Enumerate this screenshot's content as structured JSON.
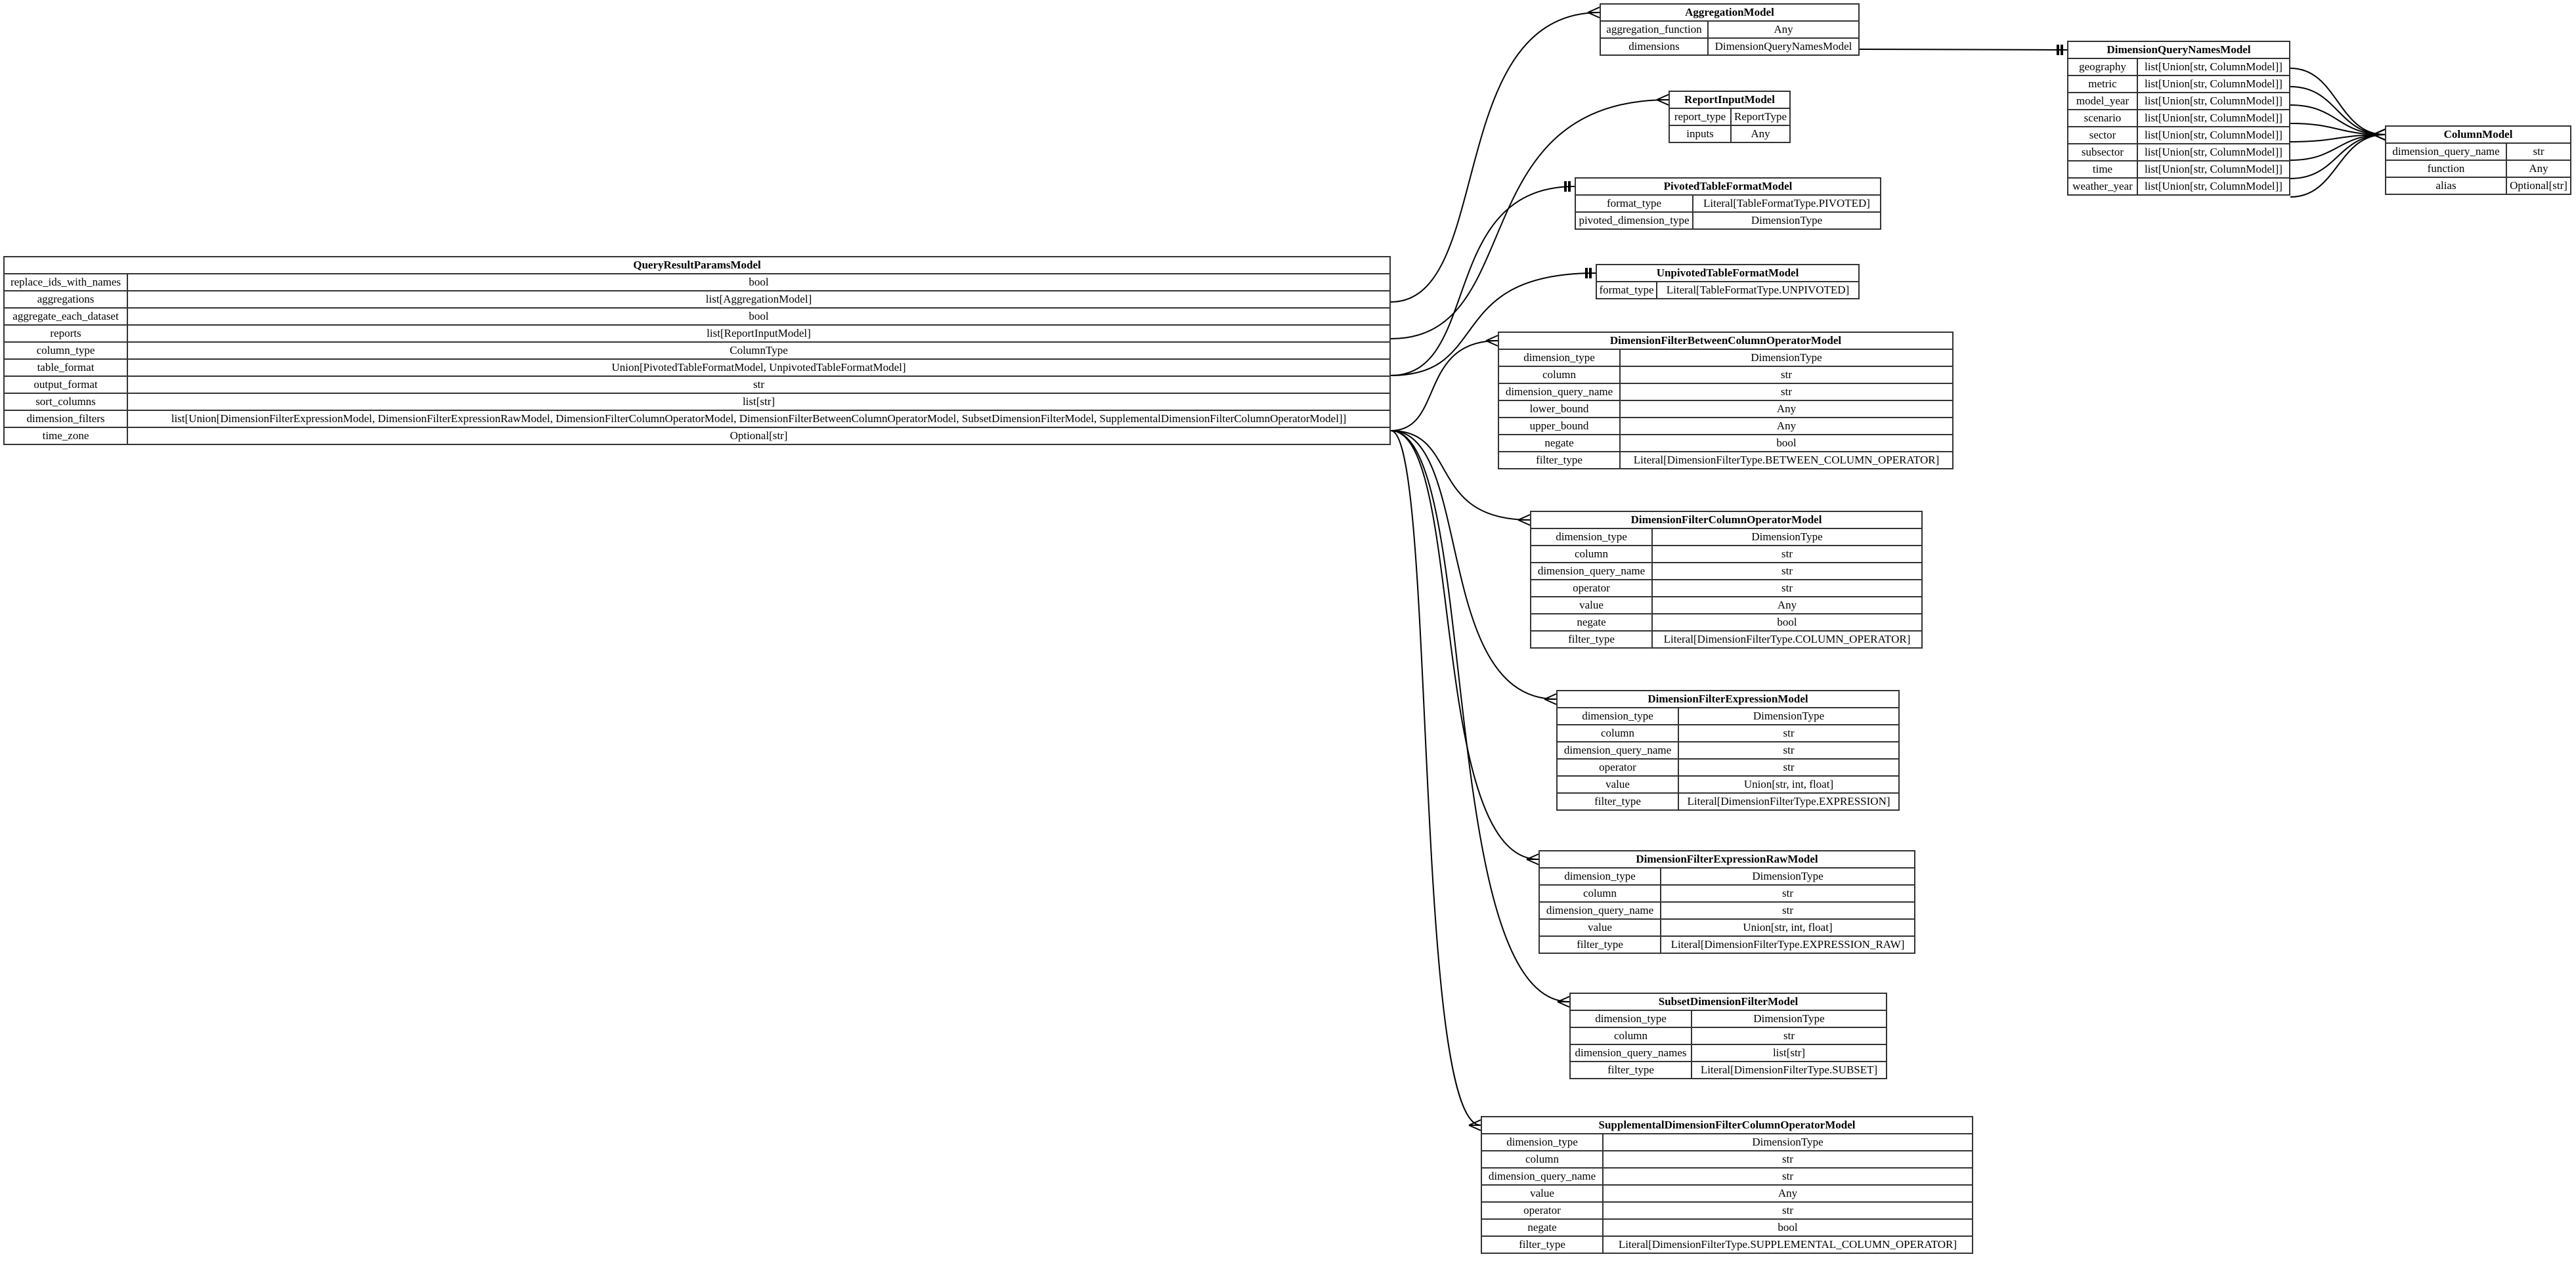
{
  "diagram": {
    "type": "entity-relationship",
    "entities": {
      "query_result_params": {
        "name": "QueryResultParamsModel",
        "fields": [
          {
            "name": "replace_ids_with_names",
            "type": "bool"
          },
          {
            "name": "aggregations",
            "type": "list[AggregationModel]"
          },
          {
            "name": "aggregate_each_dataset",
            "type": "bool"
          },
          {
            "name": "reports",
            "type": "list[ReportInputModel]"
          },
          {
            "name": "column_type",
            "type": "ColumnType"
          },
          {
            "name": "table_format",
            "type": "Union[PivotedTableFormatModel, UnpivotedTableFormatModel]"
          },
          {
            "name": "output_format",
            "type": "str"
          },
          {
            "name": "sort_columns",
            "type": "list[str]"
          },
          {
            "name": "dimension_filters",
            "type": "list[Union[DimensionFilterExpressionModel, DimensionFilterExpressionRawModel, DimensionFilterColumnOperatorModel, DimensionFilterBetweenColumnOperatorModel, SubsetDimensionFilterModel, SupplementalDimensionFilterColumnOperatorModel]]"
          },
          {
            "name": "time_zone",
            "type": "Optional[str]"
          }
        ]
      },
      "aggregation": {
        "name": "AggregationModel",
        "fields": [
          {
            "name": "aggregation_function",
            "type": "Any"
          },
          {
            "name": "dimensions",
            "type": "DimensionQueryNamesModel"
          }
        ]
      },
      "report_input": {
        "name": "ReportInputModel",
        "fields": [
          {
            "name": "report_type",
            "type": "ReportType"
          },
          {
            "name": "inputs",
            "type": "Any"
          }
        ]
      },
      "pivoted_table_format": {
        "name": "PivotedTableFormatModel",
        "fields": [
          {
            "name": "format_type",
            "type": "Literal[TableFormatType.PIVOTED]"
          },
          {
            "name": "pivoted_dimension_type",
            "type": "DimensionType"
          }
        ]
      },
      "unpivoted_table_format": {
        "name": "UnpivotedTableFormatModel",
        "fields": [
          {
            "name": "format_type",
            "type": "Literal[TableFormatType.UNPIVOTED]"
          }
        ]
      },
      "dimension_query_names": {
        "name": "DimensionQueryNamesModel",
        "fields": [
          {
            "name": "geography",
            "type": "list[Union[str, ColumnModel]]"
          },
          {
            "name": "metric",
            "type": "list[Union[str, ColumnModel]]"
          },
          {
            "name": "model_year",
            "type": "list[Union[str, ColumnModel]]"
          },
          {
            "name": "scenario",
            "type": "list[Union[str, ColumnModel]]"
          },
          {
            "name": "sector",
            "type": "list[Union[str, ColumnModel]]"
          },
          {
            "name": "subsector",
            "type": "list[Union[str, ColumnModel]]"
          },
          {
            "name": "time",
            "type": "list[Union[str, ColumnModel]]"
          },
          {
            "name": "weather_year",
            "type": "list[Union[str, ColumnModel]]"
          }
        ]
      },
      "column": {
        "name": "ColumnModel",
        "fields": [
          {
            "name": "dimension_query_name",
            "type": "str"
          },
          {
            "name": "function",
            "type": "Any"
          },
          {
            "name": "alias",
            "type": "Optional[str]"
          }
        ]
      },
      "df_between_column_operator": {
        "name": "DimensionFilterBetweenColumnOperatorModel",
        "fields": [
          {
            "name": "dimension_type",
            "type": "DimensionType"
          },
          {
            "name": "column",
            "type": "str"
          },
          {
            "name": "dimension_query_name",
            "type": "str"
          },
          {
            "name": "lower_bound",
            "type": "Any"
          },
          {
            "name": "upper_bound",
            "type": "Any"
          },
          {
            "name": "negate",
            "type": "bool"
          },
          {
            "name": "filter_type",
            "type": "Literal[DimensionFilterType.BETWEEN_COLUMN_OPERATOR]"
          }
        ]
      },
      "df_column_operator": {
        "name": "DimensionFilterColumnOperatorModel",
        "fields": [
          {
            "name": "dimension_type",
            "type": "DimensionType"
          },
          {
            "name": "column",
            "type": "str"
          },
          {
            "name": "dimension_query_name",
            "type": "str"
          },
          {
            "name": "operator",
            "type": "str"
          },
          {
            "name": "value",
            "type": "Any"
          },
          {
            "name": "negate",
            "type": "bool"
          },
          {
            "name": "filter_type",
            "type": "Literal[DimensionFilterType.COLUMN_OPERATOR]"
          }
        ]
      },
      "df_expression": {
        "name": "DimensionFilterExpressionModel",
        "fields": [
          {
            "name": "dimension_type",
            "type": "DimensionType"
          },
          {
            "name": "column",
            "type": "str"
          },
          {
            "name": "dimension_query_name",
            "type": "str"
          },
          {
            "name": "operator",
            "type": "str"
          },
          {
            "name": "value",
            "type": "Union[str, int, float]"
          },
          {
            "name": "filter_type",
            "type": "Literal[DimensionFilterType.EXPRESSION]"
          }
        ]
      },
      "df_expression_raw": {
        "name": "DimensionFilterExpressionRawModel",
        "fields": [
          {
            "name": "dimension_type",
            "type": "DimensionType"
          },
          {
            "name": "column",
            "type": "str"
          },
          {
            "name": "dimension_query_name",
            "type": "str"
          },
          {
            "name": "value",
            "type": "Union[str, int, float]"
          },
          {
            "name": "filter_type",
            "type": "Literal[DimensionFilterType.EXPRESSION_RAW]"
          }
        ]
      },
      "subset_dimension_filter": {
        "name": "SubsetDimensionFilterModel",
        "fields": [
          {
            "name": "dimension_type",
            "type": "DimensionType"
          },
          {
            "name": "column",
            "type": "str"
          },
          {
            "name": "dimension_query_names",
            "type": "list[str]"
          },
          {
            "name": "filter_type",
            "type": "Literal[DimensionFilterType.SUBSET]"
          }
        ]
      },
      "supplemental_df_column_operator": {
        "name": "SupplementalDimensionFilterColumnOperatorModel",
        "fields": [
          {
            "name": "dimension_type",
            "type": "DimensionType"
          },
          {
            "name": "column",
            "type": "str"
          },
          {
            "name": "dimension_query_name",
            "type": "str"
          },
          {
            "name": "value",
            "type": "Any"
          },
          {
            "name": "operator",
            "type": "str"
          },
          {
            "name": "negate",
            "type": "bool"
          },
          {
            "name": "filter_type",
            "type": "Literal[DimensionFilterType.SUPPLEMENTAL_COLUMN_OPERATOR]"
          }
        ]
      }
    },
    "relationships": [
      {
        "from": "query_result_params",
        "field": "aggregations",
        "to": "aggregation",
        "cardinality": "many"
      },
      {
        "from": "query_result_params",
        "field": "reports",
        "to": "report_input",
        "cardinality": "many"
      },
      {
        "from": "query_result_params",
        "field": "table_format",
        "to": "pivoted_table_format",
        "cardinality": "one"
      },
      {
        "from": "query_result_params",
        "field": "table_format",
        "to": "unpivoted_table_format",
        "cardinality": "one"
      },
      {
        "from": "query_result_params",
        "field": "dimension_filters",
        "to": "df_between_column_operator",
        "cardinality": "many"
      },
      {
        "from": "query_result_params",
        "field": "dimension_filters",
        "to": "df_column_operator",
        "cardinality": "many"
      },
      {
        "from": "query_result_params",
        "field": "dimension_filters",
        "to": "df_expression",
        "cardinality": "many"
      },
      {
        "from": "query_result_params",
        "field": "dimension_filters",
        "to": "df_expression_raw",
        "cardinality": "many"
      },
      {
        "from": "query_result_params",
        "field": "dimension_filters",
        "to": "subset_dimension_filter",
        "cardinality": "many"
      },
      {
        "from": "query_result_params",
        "field": "dimension_filters",
        "to": "supplemental_df_column_operator",
        "cardinality": "many"
      },
      {
        "from": "aggregation",
        "field": "dimensions",
        "to": "dimension_query_names",
        "cardinality": "one"
      },
      {
        "from": "dimension_query_names",
        "field": "geography",
        "to": "column",
        "cardinality": "many"
      },
      {
        "from": "dimension_query_names",
        "field": "metric",
        "to": "column",
        "cardinality": "many"
      },
      {
        "from": "dimension_query_names",
        "field": "model_year",
        "to": "column",
        "cardinality": "many"
      },
      {
        "from": "dimension_query_names",
        "field": "scenario",
        "to": "column",
        "cardinality": "many"
      },
      {
        "from": "dimension_query_names",
        "field": "sector",
        "to": "column",
        "cardinality": "many"
      },
      {
        "from": "dimension_query_names",
        "field": "subsector",
        "to": "column",
        "cardinality": "many"
      },
      {
        "from": "dimension_query_names",
        "field": "time",
        "to": "column",
        "cardinality": "many"
      },
      {
        "from": "dimension_query_names",
        "field": "weather_year",
        "to": "column",
        "cardinality": "many"
      }
    ]
  }
}
